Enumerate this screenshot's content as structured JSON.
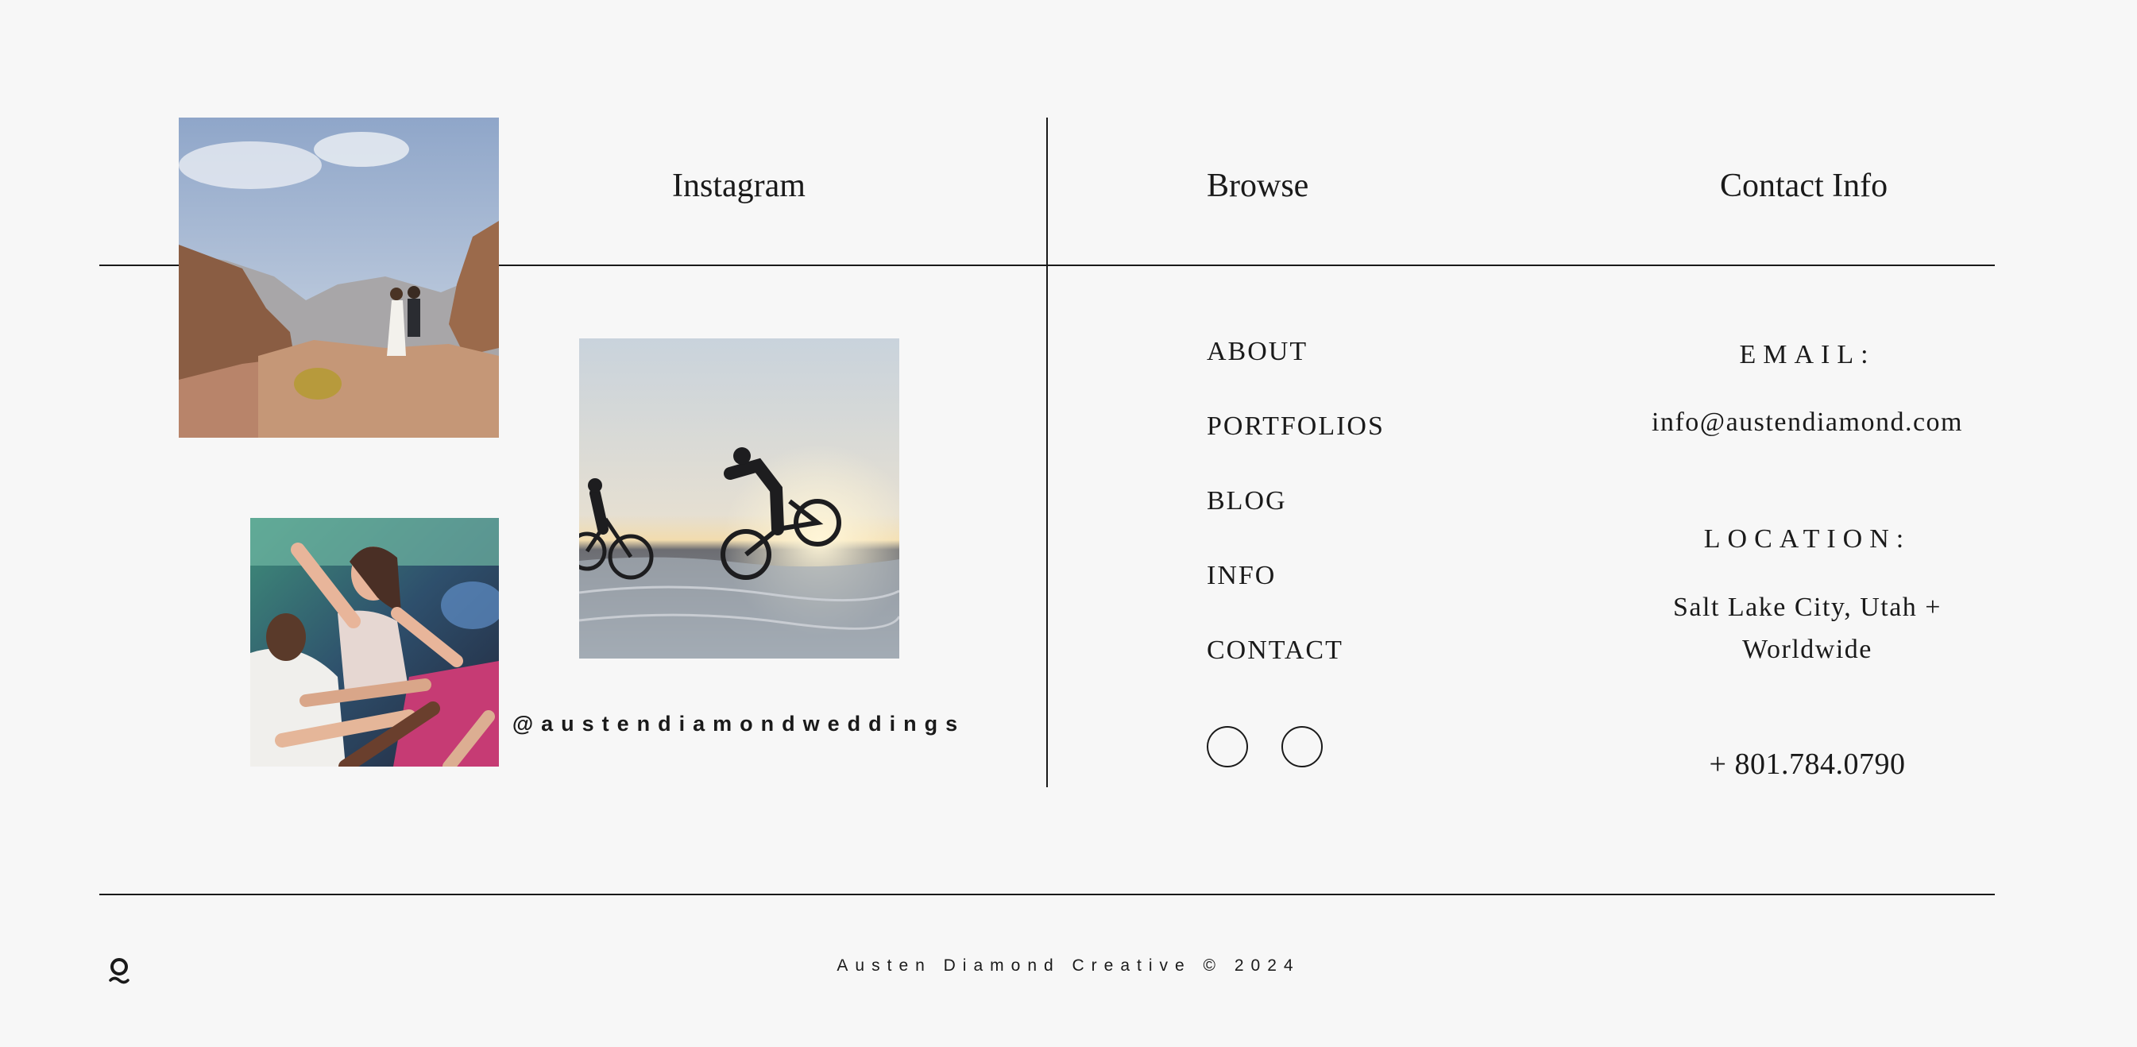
{
  "instagram": {
    "heading": "Instagram",
    "handle": "@austendiamondweddings",
    "photos": [
      {
        "subject": "couple on canyon cliff"
      },
      {
        "subject": "bikers on salt flats at sunset"
      },
      {
        "subject": "bride dancing at reception"
      }
    ]
  },
  "browse": {
    "heading": "Browse",
    "links": [
      {
        "label": "ABOUT"
      },
      {
        "label": "PORTFOLIOS"
      },
      {
        "label": "BLOG"
      },
      {
        "label": "INFO"
      },
      {
        "label": "CONTACT"
      }
    ],
    "social_icons": [
      "social-icon-1",
      "social-icon-2"
    ]
  },
  "contact": {
    "heading": "Contact Info",
    "email_label": "EMAIL:",
    "email_value": "info@austendiamond.com",
    "location_label": "LOCATION:",
    "location_line1": "Salt Lake City, Utah +",
    "location_line2": "Worldwide",
    "phone": "+ 801.784.0790"
  },
  "footer": {
    "copyright": "Austen Diamond Creative © 2024",
    "logo_icon": "ad-monogram-icon"
  },
  "colors": {
    "background": "#f7f7f7",
    "text": "#1a1a1a"
  }
}
